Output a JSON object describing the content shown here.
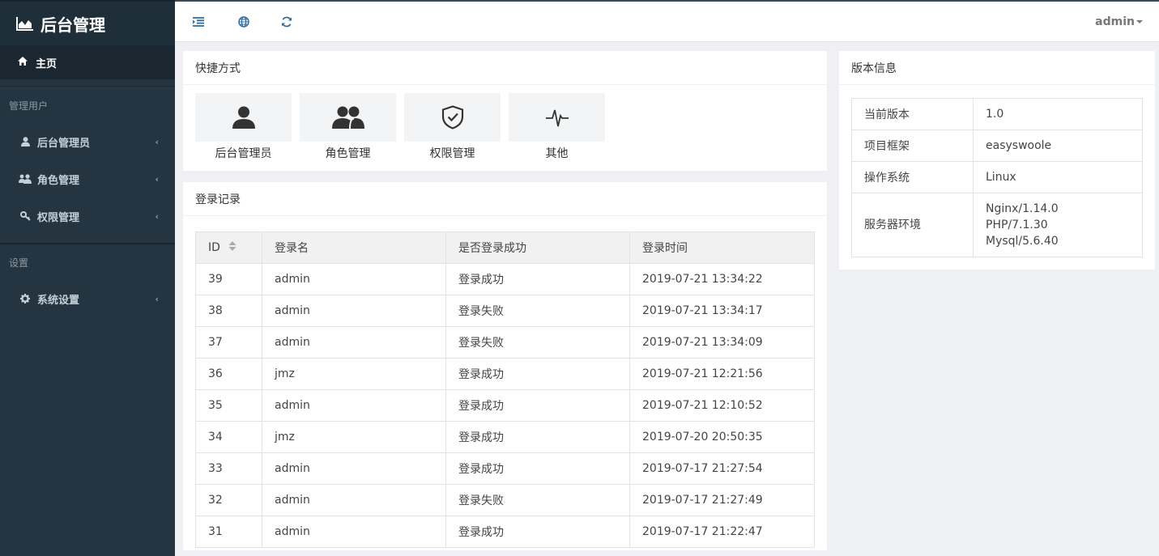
{
  "brand": {
    "title": "后台管理"
  },
  "sidebar": {
    "home": "主页",
    "sections": [
      {
        "header": "管理用户",
        "items": [
          {
            "label": "后台管理员",
            "icon": "user-icon"
          },
          {
            "label": "角色管理",
            "icon": "users-icon"
          },
          {
            "label": "权限管理",
            "icon": "key-icon"
          }
        ]
      },
      {
        "header": "设置",
        "items": [
          {
            "label": "系统设置",
            "icon": "gear-icon"
          }
        ]
      }
    ]
  },
  "topbar": {
    "icons": [
      "indent-icon",
      "globe-icon",
      "refresh-icon"
    ],
    "user": "admin"
  },
  "shortcuts": {
    "title": "快捷方式",
    "items": [
      {
        "label": "后台管理员",
        "icon": "user-icon"
      },
      {
        "label": "角色管理",
        "icon": "users-icon"
      },
      {
        "label": "权限管理",
        "icon": "shield-check-icon"
      },
      {
        "label": "其他",
        "icon": "pulse-icon"
      }
    ]
  },
  "login_log": {
    "title": "登录记录",
    "columns": [
      "ID",
      "登录名",
      "是否登录成功",
      "登录时间"
    ],
    "rows": [
      {
        "id": "39",
        "name": "admin",
        "status": "登录成功",
        "success": true,
        "time": "2019-07-21 13:34:22"
      },
      {
        "id": "38",
        "name": "admin",
        "status": "登录失败",
        "success": false,
        "time": "2019-07-21 13:34:17"
      },
      {
        "id": "37",
        "name": "admin",
        "status": "登录失败",
        "success": false,
        "time": "2019-07-21 13:34:09"
      },
      {
        "id": "36",
        "name": "jmz",
        "status": "登录成功",
        "success": true,
        "time": "2019-07-21 12:21:56"
      },
      {
        "id": "35",
        "name": "admin",
        "status": "登录成功",
        "success": true,
        "time": "2019-07-21 12:10:52"
      },
      {
        "id": "34",
        "name": "jmz",
        "status": "登录成功",
        "success": true,
        "time": "2019-07-20 20:50:35"
      },
      {
        "id": "33",
        "name": "admin",
        "status": "登录成功",
        "success": true,
        "time": "2019-07-17 21:27:54"
      },
      {
        "id": "32",
        "name": "admin",
        "status": "登录失败",
        "success": false,
        "time": "2019-07-17 21:27:49"
      },
      {
        "id": "31",
        "name": "admin",
        "status": "登录成功",
        "success": true,
        "time": "2019-07-17 21:22:47"
      }
    ]
  },
  "version_info": {
    "title": "版本信息",
    "rows": [
      {
        "key": "当前版本",
        "value": "1.0"
      },
      {
        "key": "项目框架",
        "value": "easyswoole"
      },
      {
        "key": "操作系统",
        "value": "Linux"
      },
      {
        "key": "服务器环境",
        "values": [
          "Nginx/1.14.0",
          "PHP/7.1.30",
          "Mysql/5.6.40"
        ]
      }
    ]
  },
  "colors": {
    "sidebar": "#243541",
    "success": "#e5497d",
    "link": "#2d6ca2"
  }
}
